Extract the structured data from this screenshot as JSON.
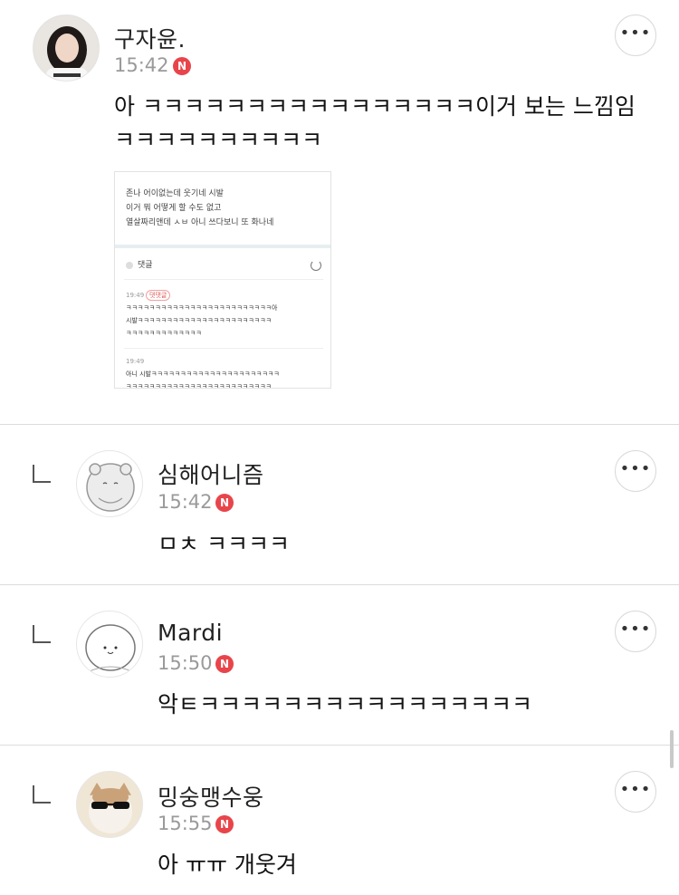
{
  "comments": [
    {
      "name": "구자윤.",
      "time": "15:42",
      "badge": "N",
      "text_line1": "아 ㅋㅋㅋㅋㅋㅋㅋㅋㅋㅋㅋㅋㅋㅋㅋㅋ이거 보는  느낌임",
      "text_line2": "ㅋㅋㅋㅋㅋㅋㅋㅋㅋㅋ",
      "more": "•••",
      "attachment": {
        "post_line1": "존나 어이없는데 웃기네 시발",
        "post_line2": "이거 뭐 어떻게 할 수도 없고",
        "post_line3": "열살짜리앤데 ㅅㅂ 아니 쓰다보니 또 화나네",
        "comments_label": "댓글",
        "c1_time": "19:49",
        "c1_tag": "댓댓글",
        "c1_line1": "ㅋㅋㅋㅋㅋㅋㅋㅋㅋㅋㅋㅋㅋㅋㅋㅋㅋㅋㅋㅋㅋㅋㅋㅋㅋ아",
        "c1_line2": "시발ㅋㅋㅋㅋㅋㅋㅋㅋㅋㅋㅋㅋㅋㅋㅋㅋㅋㅋㅋㅋㅋㅋㅋ",
        "c1_line3": "ㅋㅋㅋㅋㅋㅋㅋㅋㅋㅋㅋㅋㅋ",
        "c2_time": "19:49",
        "c2_line1": "아니 시발ㅋㅋㅋㅋㅋㅋㅋㅋㅋㅋㅋㅋㅋㅋㅋㅋㅋㅋㅋㅋㅋㅋ",
        "c2_line2": "ㅋㅋㅋㅋㅋㅋㅋㅋㅋㅋㅋㅋㅋㅋㅋㅋㅋㅋㅋㅋㅋㅋㅋㅋㅋ"
      }
    },
    {
      "name": "심해어니즘",
      "time": "15:42",
      "badge": "N",
      "text": "ㅁㅊ ㅋㅋㅋㅋ",
      "more": "•••"
    },
    {
      "name": "Mardi",
      "time": "15:50",
      "badge": "N",
      "text": "악ㅌㅋㅋㅋㅋㅋㅋㅋㅋㅋㅋㅋㅋㅋㅋㅋㅋ",
      "more": "•••"
    },
    {
      "name": "밍숭맹수웅",
      "time": "15:55",
      "badge": "N",
      "text": "아 ㅠㅠ 개웃겨",
      "more": "•••"
    }
  ]
}
